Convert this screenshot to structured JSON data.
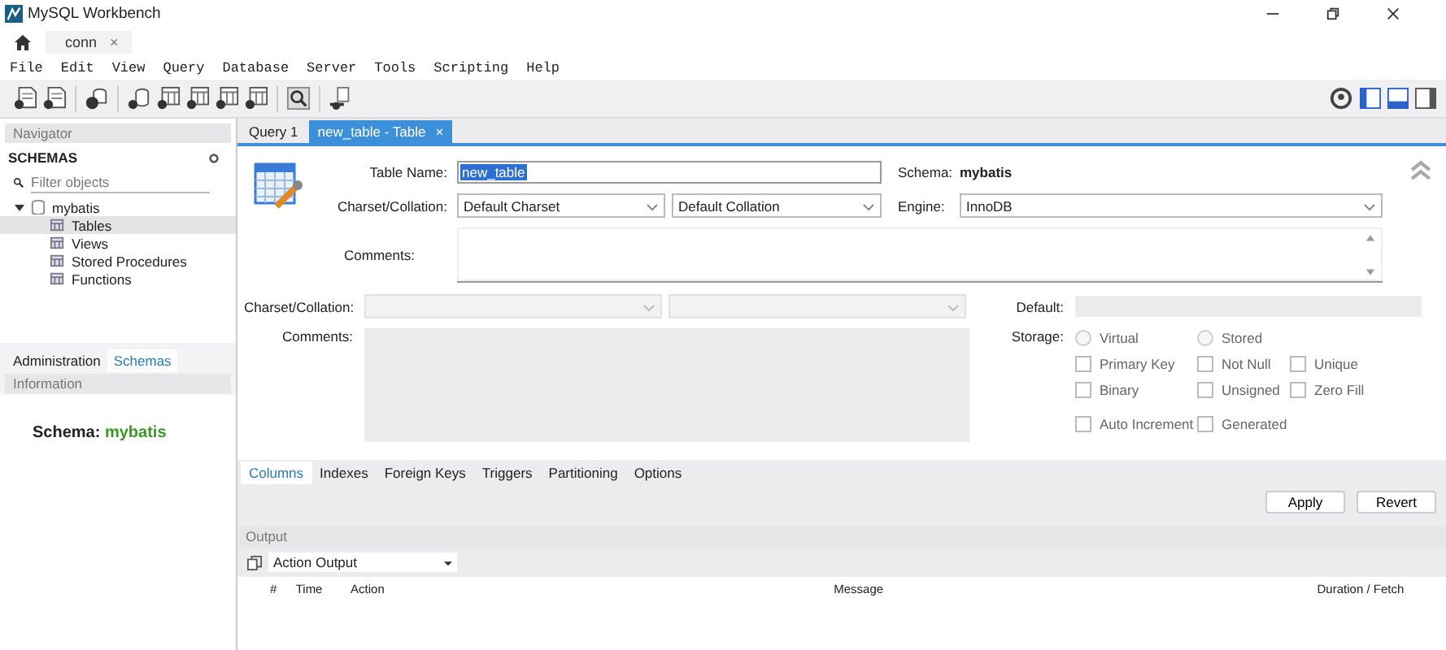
{
  "window": {
    "title": "MySQL Workbench"
  },
  "connection_tabs": [
    {
      "label": "conn",
      "close": "×",
      "selected": true
    }
  ],
  "menu": [
    "File",
    "Edit",
    "View",
    "Query",
    "Database",
    "Server",
    "Tools",
    "Scripting",
    "Help"
  ],
  "navigator": {
    "title": "Navigator",
    "section": "SCHEMAS",
    "filter": {
      "placeholder": "Filter objects"
    },
    "tree": [
      {
        "label": "mybatis",
        "expanded": true,
        "selected": false,
        "children": [
          {
            "label": "Tables",
            "selected": true
          },
          {
            "label": "Views",
            "selected": false
          },
          {
            "label": "Stored Procedures",
            "selected": false
          },
          {
            "label": "Functions",
            "selected": false
          }
        ]
      }
    ],
    "tabs": [
      {
        "label": "Administration",
        "selected": false
      },
      {
        "label": "Schemas",
        "selected": true
      }
    ],
    "information": {
      "title": "Information",
      "label": "Schema:",
      "value": "mybatis"
    }
  },
  "editor_tabs": [
    {
      "label": "Query 1",
      "selected": false
    },
    {
      "label": "new_table - Table",
      "close": "×",
      "selected": true
    }
  ],
  "table_form": {
    "table_name_label": "Table Name:",
    "table_name": "new_table",
    "schema_label": "Schema:",
    "schema": "mybatis",
    "charset_label": "Charset/Collation:",
    "charset": "Default Charset",
    "collation": "Default Collation",
    "engine_label": "Engine:",
    "engine": "InnoDB",
    "comments_label": "Comments:"
  },
  "column_details": {
    "charset_label": "Charset/Collation:",
    "comments_label": "Comments:",
    "default_label": "Default:",
    "storage_label": "Storage:",
    "storage": [
      {
        "label": "Virtual",
        "selected": false
      },
      {
        "label": "Stored",
        "selected": false
      }
    ],
    "flags": [
      {
        "label": "Primary Key",
        "checked": false
      },
      {
        "label": "Not Null",
        "checked": false
      },
      {
        "label": "Unique",
        "checked": false
      },
      {
        "label": "Binary",
        "checked": false
      },
      {
        "label": "Unsigned",
        "checked": false
      },
      {
        "label": "Zero Fill",
        "checked": false
      },
      {
        "label": "Auto Increment",
        "checked": false
      },
      {
        "label": "Generated",
        "checked": false
      }
    ]
  },
  "detail_tabs": [
    {
      "label": "Columns",
      "selected": true
    },
    {
      "label": "Indexes",
      "selected": false
    },
    {
      "label": "Foreign Keys",
      "selected": false
    },
    {
      "label": "Triggers",
      "selected": false
    },
    {
      "label": "Partitioning",
      "selected": false
    },
    {
      "label": "Options",
      "selected": false
    }
  ],
  "buttons": [
    "Apply",
    "Revert"
  ],
  "output": {
    "title": "Output",
    "selector": "Action Output",
    "columns": [
      "#",
      "Time",
      "Action",
      "Message",
      "Duration / Fetch"
    ]
  }
}
